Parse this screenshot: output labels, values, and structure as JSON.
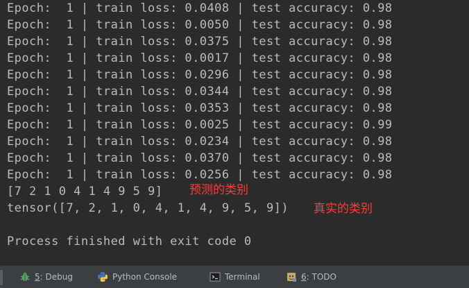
{
  "console": {
    "lines": [
      "Epoch:  1 | train loss: 0.0408 | test accuracy: 0.98",
      "Epoch:  1 | train loss: 0.0050 | test accuracy: 0.98",
      "Epoch:  1 | train loss: 0.0375 | test accuracy: 0.98",
      "Epoch:  1 | train loss: 0.0017 | test accuracy: 0.98",
      "Epoch:  1 | train loss: 0.0296 | test accuracy: 0.98",
      "Epoch:  1 | train loss: 0.0344 | test accuracy: 0.98",
      "Epoch:  1 | train loss: 0.0353 | test accuracy: 0.98",
      "Epoch:  1 | train loss: 0.0025 | test accuracy: 0.99",
      "Epoch:  1 | train loss: 0.0234 | test accuracy: 0.98",
      "Epoch:  1 | train loss: 0.0370 | test accuracy: 0.98",
      "Epoch:  1 | train loss: 0.0256 | test accuracy: 0.98"
    ],
    "prediction_line": "[7 2 1 0 4 1 4 9 5 9]",
    "prediction_annotation": "预测的类别",
    "truth_line": "tensor([7, 2, 1, 0, 4, 1, 4, 9, 5, 9])",
    "truth_annotation": "真实的类别",
    "exit_line": "Process finished with exit code 0"
  },
  "toolbar": {
    "debug": {
      "num": "5",
      "label": ": Debug",
      "icon": "bug-icon"
    },
    "python_console": {
      "label": "Python Console",
      "icon": "python-icon"
    },
    "terminal": {
      "label": "Terminal",
      "icon": "terminal-icon"
    },
    "todo": {
      "num": "6",
      "label": ": TODO",
      "icon": "todo-icon"
    }
  },
  "colors": {
    "console_bg": "#2b2b2b",
    "console_text": "#bbbbbb",
    "annotation": "#ff3b3b",
    "toolbar_bg": "#3c3f41"
  }
}
